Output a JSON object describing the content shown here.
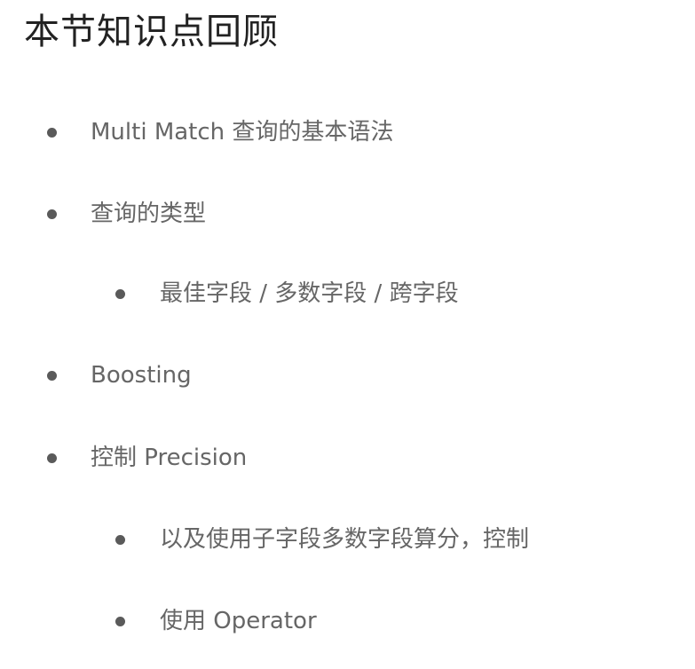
{
  "title": "本节知识点回顾",
  "items": [
    {
      "text": "Multi Match 查询的基本语法"
    },
    {
      "text": "查询的类型"
    },
    {
      "text": "最佳字段 / 多数字段 / 跨字段"
    },
    {
      "text": "Boosting"
    },
    {
      "text": "控制 Precision"
    },
    {
      "text": "以及使用子字段多数字段算分，控制"
    },
    {
      "text": "使用 Operator"
    }
  ]
}
